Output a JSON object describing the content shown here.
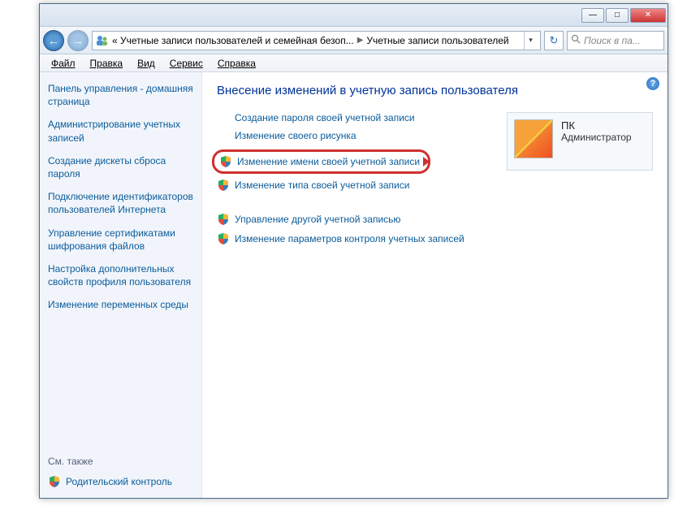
{
  "titlebar": {
    "minimize": "—",
    "maximize": "□",
    "close": "✕"
  },
  "nav": {
    "back": "←",
    "forward": "→",
    "breadcrumb_first": "« Учетные записи пользователей и семейная безоп...",
    "breadcrumb_last": "Учетные записи пользователей",
    "breadcrumb_sep": "▶",
    "dropdown": "▾",
    "refresh": "↻",
    "search_placeholder": "Поиск в па..."
  },
  "menu": {
    "file": "Файл",
    "edit": "Правка",
    "view": "Вид",
    "tools": "Сервис",
    "help": "Справка"
  },
  "sidebar": {
    "items": [
      "Панель управления - домашняя страница",
      "Администрирование учетных записей",
      "Создание дискеты сброса пароля",
      "Подключение идентификаторов пользователей Интернета",
      "Управление сертификатами шифрования файлов",
      "Настройка дополнительных свойств профиля пользователя",
      "Изменение переменных среды"
    ],
    "see_also": "См. также",
    "parental": "Родительский контроль"
  },
  "main": {
    "help": "?",
    "heading": "Внесение изменений в учетную запись пользователя",
    "tasks": {
      "create_password": "Создание пароля своей учетной записи",
      "change_picture": "Изменение своего рисунка",
      "change_name": "Изменение имени своей учетной записи",
      "change_type": "Изменение типа своей учетной записи",
      "manage_other": "Управление другой учетной записью",
      "uac_settings": "Изменение параметров контроля учетных записей"
    },
    "user": {
      "name": "ПК",
      "role": "Администратор"
    }
  }
}
